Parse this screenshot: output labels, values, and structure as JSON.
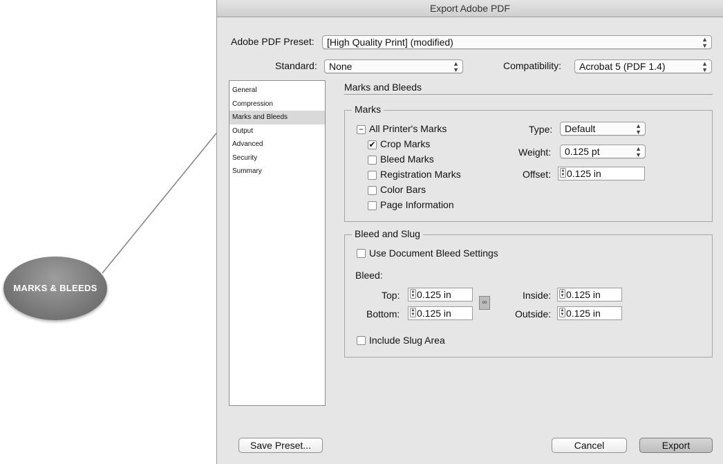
{
  "window": {
    "title": "Export Adobe PDF"
  },
  "preset": {
    "label": "Adobe PDF Preset:",
    "value": "[High Quality Print] (modified)"
  },
  "standard": {
    "label": "Standard:",
    "value": "None"
  },
  "compatibility": {
    "label": "Compatibility:",
    "value": "Acrobat 5 (PDF 1.4)"
  },
  "sidebar": {
    "items": [
      {
        "label": "General"
      },
      {
        "label": "Compression"
      },
      {
        "label": "Marks and Bleeds"
      },
      {
        "label": "Output"
      },
      {
        "label": "Advanced"
      },
      {
        "label": "Security"
      },
      {
        "label": "Summary"
      }
    ]
  },
  "section": {
    "title": "Marks and Bleeds"
  },
  "marks": {
    "group_title": "Marks",
    "all_printers": {
      "label": "All Printer's Marks"
    },
    "crop": {
      "label": "Crop Marks",
      "checked": true
    },
    "bleed": {
      "label": "Bleed Marks",
      "checked": false
    },
    "registration": {
      "label": "Registration Marks",
      "checked": false
    },
    "color_bars": {
      "label": "Color Bars",
      "checked": false
    },
    "page_info": {
      "label": "Page Information",
      "checked": false
    },
    "type": {
      "label": "Type:",
      "value": "Default"
    },
    "weight": {
      "label": "Weight:",
      "value": "0.125 pt"
    },
    "offset": {
      "label": "Offset:",
      "value": "0.125 in"
    }
  },
  "bleed_slug": {
    "group_title": "Bleed and Slug",
    "use_doc": {
      "label": "Use Document Bleed Settings",
      "checked": false
    },
    "bleed_label": "Bleed:",
    "top": {
      "label": "Top:",
      "value": "0.125 in"
    },
    "bottom": {
      "label": "Bottom:",
      "value": "0.125 in"
    },
    "inside": {
      "label": "Inside:",
      "value": "0.125 in"
    },
    "outside": {
      "label": "Outside:",
      "value": "0.125 in"
    },
    "slug": {
      "label": "Include Slug Area",
      "checked": false
    }
  },
  "buttons": {
    "save_preset": "Save Preset...",
    "cancel": "Cancel",
    "export": "Export"
  },
  "callout": {
    "text": "MARKS & BLEEDS"
  },
  "icons": {
    "select_arrows": "↕",
    "checkmark": "✔",
    "dash": "−",
    "link": "chain-link-icon"
  }
}
